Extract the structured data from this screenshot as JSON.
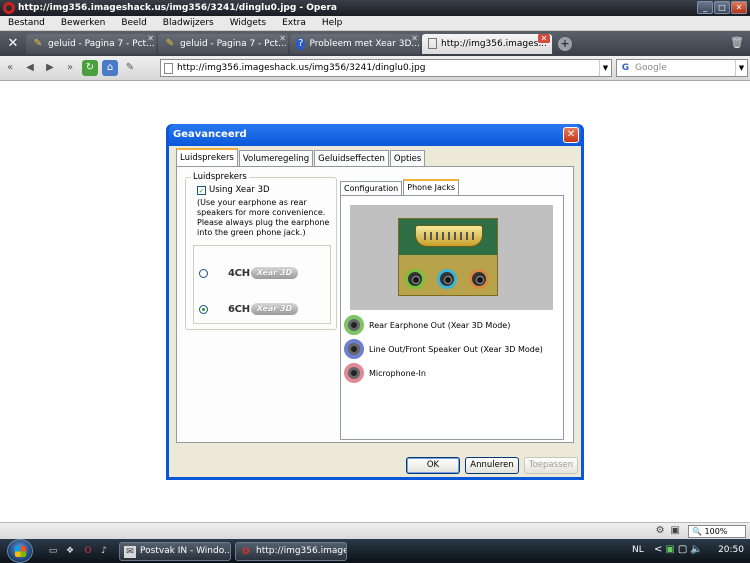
{
  "window": {
    "title": "http://img356.imageshack.us/img356/3241/dinglu0.jpg - Opera"
  },
  "menu": [
    "Bestand",
    "Bewerken",
    "Beeld",
    "Bladwijzers",
    "Widgets",
    "Extra",
    "Help"
  ],
  "tabs": [
    {
      "label": "geluid - Pagina 7 - Pct...",
      "icon": "tools-icon",
      "active": false
    },
    {
      "label": "geluid - Pagina 7 - Pct...",
      "icon": "tools-icon",
      "active": false
    },
    {
      "label": "Probleem met Xear 3D...",
      "icon": "help-icon",
      "active": false
    },
    {
      "label": "http://img356.images...",
      "icon": "page-icon",
      "active": true
    }
  ],
  "address": {
    "url": "http://img356.imageshack.us/img356/3241/dinglu0.jpg",
    "search_placeholder": "Google"
  },
  "dialog": {
    "title": "Geavanceerd",
    "tabs": [
      "Luidsprekers",
      "Volumeregeling",
      "Geluidseffecten",
      "Opties"
    ],
    "group_label": "Luidsprekers",
    "checkbox_label": "Using Xear 3D",
    "checkbox_checked": true,
    "description": "(Use your earphone as rear speakers for more convenience. Please always plug the earphone into the green phone jack.)",
    "modes": [
      {
        "label": "4CH",
        "logo": "Xear 3D",
        "selected": false
      },
      {
        "label": "6CH",
        "logo": "Xear 3D",
        "selected": true
      }
    ],
    "subtabs": [
      "Configuration",
      "Phone Jacks"
    ],
    "jacks": [
      {
        "label": "Rear Earphone Out (Xear 3D Mode)",
        "color": "#7cc466"
      },
      {
        "label": "Line Out/Front Speaker Out (Xear 3D Mode)",
        "color": "#6e7fd0"
      },
      {
        "label": "Microphone-In",
        "color": "#e08a96"
      }
    ],
    "photo_jack_colors": [
      "#76c23a",
      "#3ab4d8",
      "#d88a40"
    ],
    "buttons": {
      "ok": "OK",
      "cancel": "Annuleren",
      "apply": "Toepassen"
    }
  },
  "statusbar": {
    "zoom": "100%"
  },
  "taskbar": {
    "items": [
      {
        "label": "Postvak IN - Windo...",
        "icon": "mail-icon"
      },
      {
        "label": "http://img356.imagea...",
        "icon": "opera-icon"
      }
    ],
    "language": "NL",
    "clock": "20:50"
  }
}
